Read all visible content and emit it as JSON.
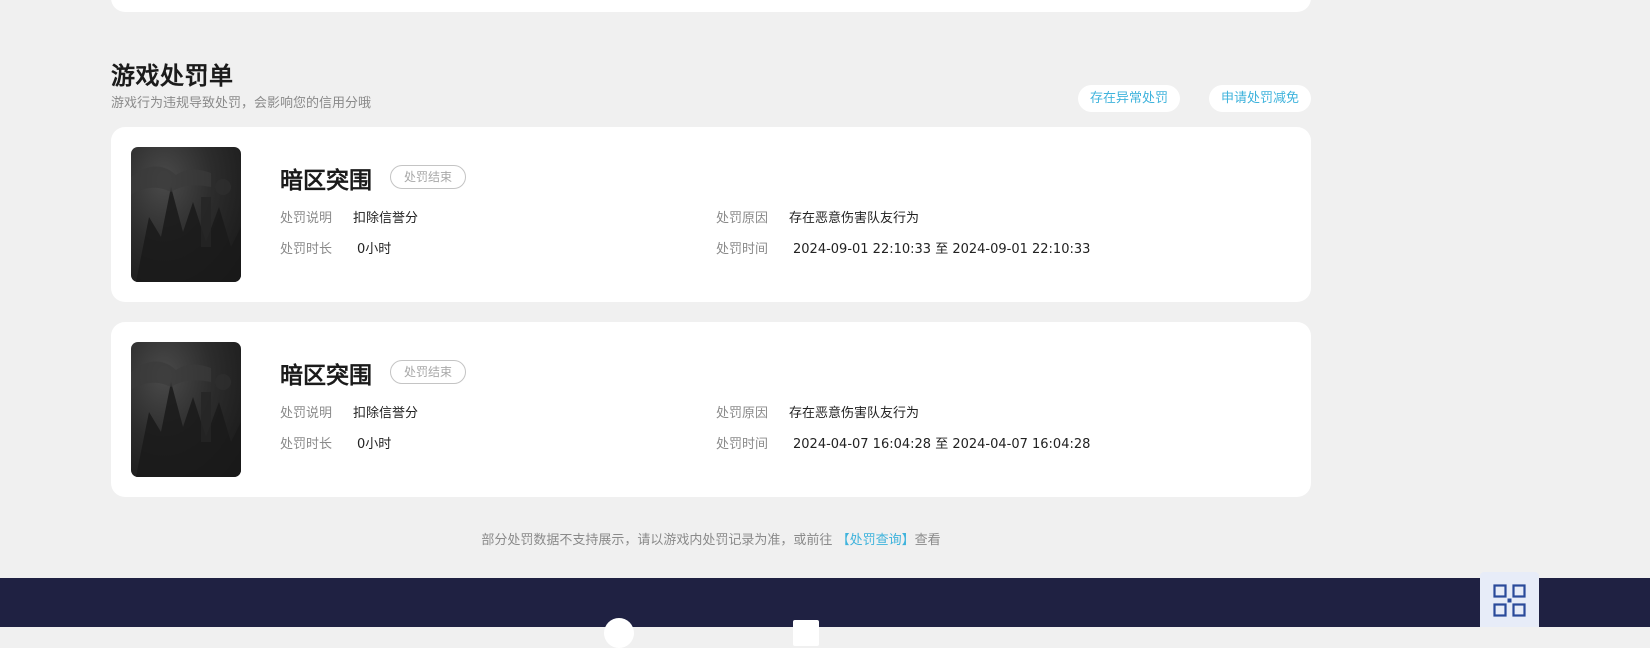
{
  "section": {
    "title": "游戏处罚单",
    "subtitle": "游戏行为违规导致处罚，会影响您的信用分哦",
    "buttons": {
      "abnormal": "存在异常处罚",
      "reduce": "申请处罚减免"
    }
  },
  "records": [
    {
      "game_name": "暗区突围",
      "status": "处罚结束",
      "desc_label": "处罚说明",
      "desc_value": "扣除信誉分",
      "reason_label": "处罚原因",
      "reason_value": "存在恶意伤害队友行为",
      "duration_label": "处罚时长",
      "duration_value": "0小时",
      "time_label": "处罚时间",
      "time_value": "2024-09-01 22:10:33 至 2024-09-01 22:10:33"
    },
    {
      "game_name": "暗区突围",
      "status": "处罚结束",
      "desc_label": "处罚说明",
      "desc_value": "扣除信誉分",
      "reason_label": "处罚原因",
      "reason_value": "存在恶意伤害队友行为",
      "duration_label": "处罚时长",
      "duration_value": "0小时",
      "time_label": "处罚时间",
      "time_value": "2024-04-07 16:04:28 至 2024-04-07 16:04:28"
    }
  ],
  "footer_note": {
    "prefix": "部分处罚数据不支持展示，请以游戏内处罚记录为准，或前往",
    "link": "【处罚查询】",
    "suffix": "查看"
  },
  "icons": {
    "qr": "qr-code-icon"
  },
  "colors": {
    "accent": "#3fb3dc",
    "footer_bg": "#1f2142",
    "page_bg": "#f0f0f0"
  }
}
